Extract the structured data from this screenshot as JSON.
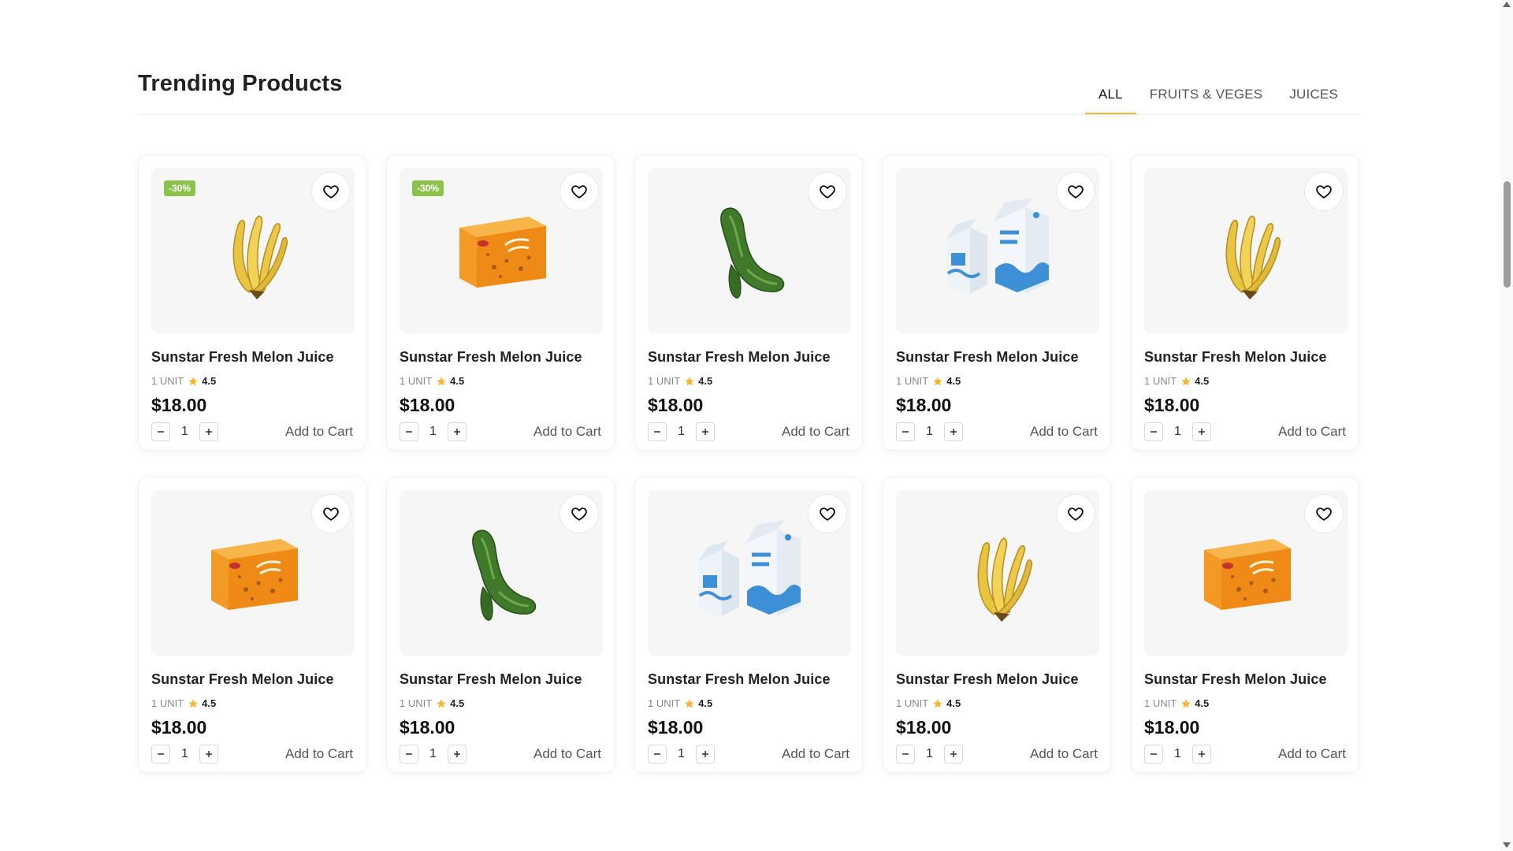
{
  "section": {
    "title": "Trending Products"
  },
  "tabs": [
    {
      "label": "All",
      "active": true
    },
    {
      "label": "Fruits & Veges",
      "active": false
    },
    {
      "label": "Juices",
      "active": false
    }
  ],
  "products": [
    {
      "name": "Sunstar Fresh Melon Juice",
      "unit": "1 UNIT",
      "rating": "4.5",
      "price": "$18.00",
      "qty": "1",
      "add_label": "Add to Cart",
      "badge": "-30%",
      "image": "banana"
    },
    {
      "name": "Sunstar Fresh Melon Juice",
      "unit": "1 UNIT",
      "rating": "4.5",
      "price": "$18.00",
      "qty": "1",
      "add_label": "Add to Cart",
      "badge": "-30%",
      "image": "cookies-box"
    },
    {
      "name": "Sunstar Fresh Melon Juice",
      "unit": "1 UNIT",
      "rating": "4.5",
      "price": "$18.00",
      "qty": "1",
      "add_label": "Add to Cart",
      "badge": "",
      "image": "cucumber"
    },
    {
      "name": "Sunstar Fresh Melon Juice",
      "unit": "1 UNIT",
      "rating": "4.5",
      "price": "$18.00",
      "qty": "1",
      "add_label": "Add to Cart",
      "badge": "",
      "image": "milk-cartons"
    },
    {
      "name": "Sunstar Fresh Melon Juice",
      "unit": "1 UNIT",
      "rating": "4.5",
      "price": "$18.00",
      "qty": "1",
      "add_label": "Add to Cart",
      "badge": "",
      "image": "banana"
    },
    {
      "name": "Sunstar Fresh Melon Juice",
      "unit": "1 UNIT",
      "rating": "4.5",
      "price": "$18.00",
      "qty": "1",
      "add_label": "Add to Cart",
      "badge": "",
      "image": "cookies-box"
    },
    {
      "name": "Sunstar Fresh Melon Juice",
      "unit": "1 UNIT",
      "rating": "4.5",
      "price": "$18.00",
      "qty": "1",
      "add_label": "Add to Cart",
      "badge": "",
      "image": "cucumber"
    },
    {
      "name": "Sunstar Fresh Melon Juice",
      "unit": "1 UNIT",
      "rating": "4.5",
      "price": "$18.00",
      "qty": "1",
      "add_label": "Add to Cart",
      "badge": "",
      "image": "milk-cartons"
    },
    {
      "name": "Sunstar Fresh Melon Juice",
      "unit": "1 UNIT",
      "rating": "4.5",
      "price": "$18.00",
      "qty": "1",
      "add_label": "Add to Cart",
      "badge": "",
      "image": "banana"
    },
    {
      "name": "Sunstar Fresh Melon Juice",
      "unit": "1 UNIT",
      "rating": "4.5",
      "price": "$18.00",
      "qty": "1",
      "add_label": "Add to Cart",
      "badge": "",
      "image": "cookies-box"
    }
  ],
  "icons": {
    "wishlist": "heart-icon",
    "rating": "star-icon",
    "decrease": "minus-icon",
    "increase": "plus-icon"
  },
  "colors": {
    "accent": "#f2b53a",
    "badge": "#8bc34a",
    "star": "#f5b731",
    "card_media_bg": "#f6f6f6"
  }
}
